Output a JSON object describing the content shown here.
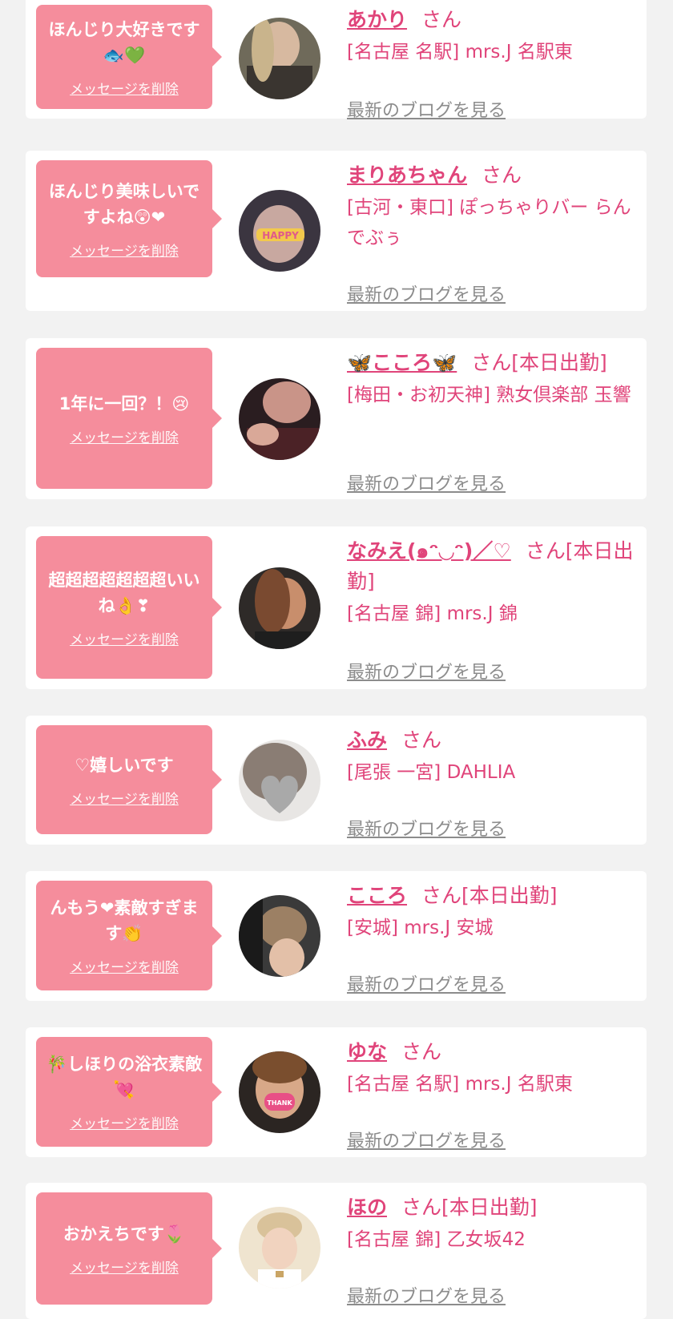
{
  "delete_label": "メッセージを削除",
  "blog_label": "最新のブログを見る",
  "colors": {
    "background": "#f2f2f2",
    "card": "#ffffff",
    "bubble": "#f58d9c",
    "accent": "#e0447a",
    "muted": "#8c8c8c"
  },
  "entries": [
    {
      "message": "ほんじり大好きです🐟💚",
      "name": "あかり",
      "suffix": "さん",
      "shop": "[名古屋 名駅] mrs.J 名駅東"
    },
    {
      "message": "ほんじり美味しいですよね😲❤",
      "name": "まりあちゃん",
      "suffix": "さん",
      "shop": "[古河・東口] ぽっちゃりバー らんでぶぅ"
    },
    {
      "message": "1年に一回？！😢",
      "name": "🦋こころ🦋",
      "suffix": "さん[本日出勤]",
      "shop": "[梅田・お初天神] 熟女倶楽部 玉響"
    },
    {
      "message": "超超超超超超超いいね👌❣",
      "name": "なみえ(๑ᵔ◡ᵔ)／♡",
      "suffix": "さん[本日出勤]",
      "shop": "[名古屋 錦] mrs.J 錦"
    },
    {
      "message": "♡嬉しいです",
      "name": "ふみ",
      "suffix": "さん",
      "shop": "[尾張 一宮] DAHLIA"
    },
    {
      "message": "んもう❤素敵すぎます👏",
      "name": "こころ",
      "suffix": "さん[本日出勤]",
      "shop": "[安城] mrs.J 安城"
    },
    {
      "message": "🎋しほりの浴衣素敵💘",
      "name": "ゆな",
      "suffix": "さん",
      "shop": "[名古屋 名駅] mrs.J 名駅東"
    },
    {
      "message": "おかえちです🌷",
      "name": "ほの",
      "suffix": "さん[本日出勤]",
      "shop": "[名古屋 錦] 乙女坂42"
    }
  ]
}
